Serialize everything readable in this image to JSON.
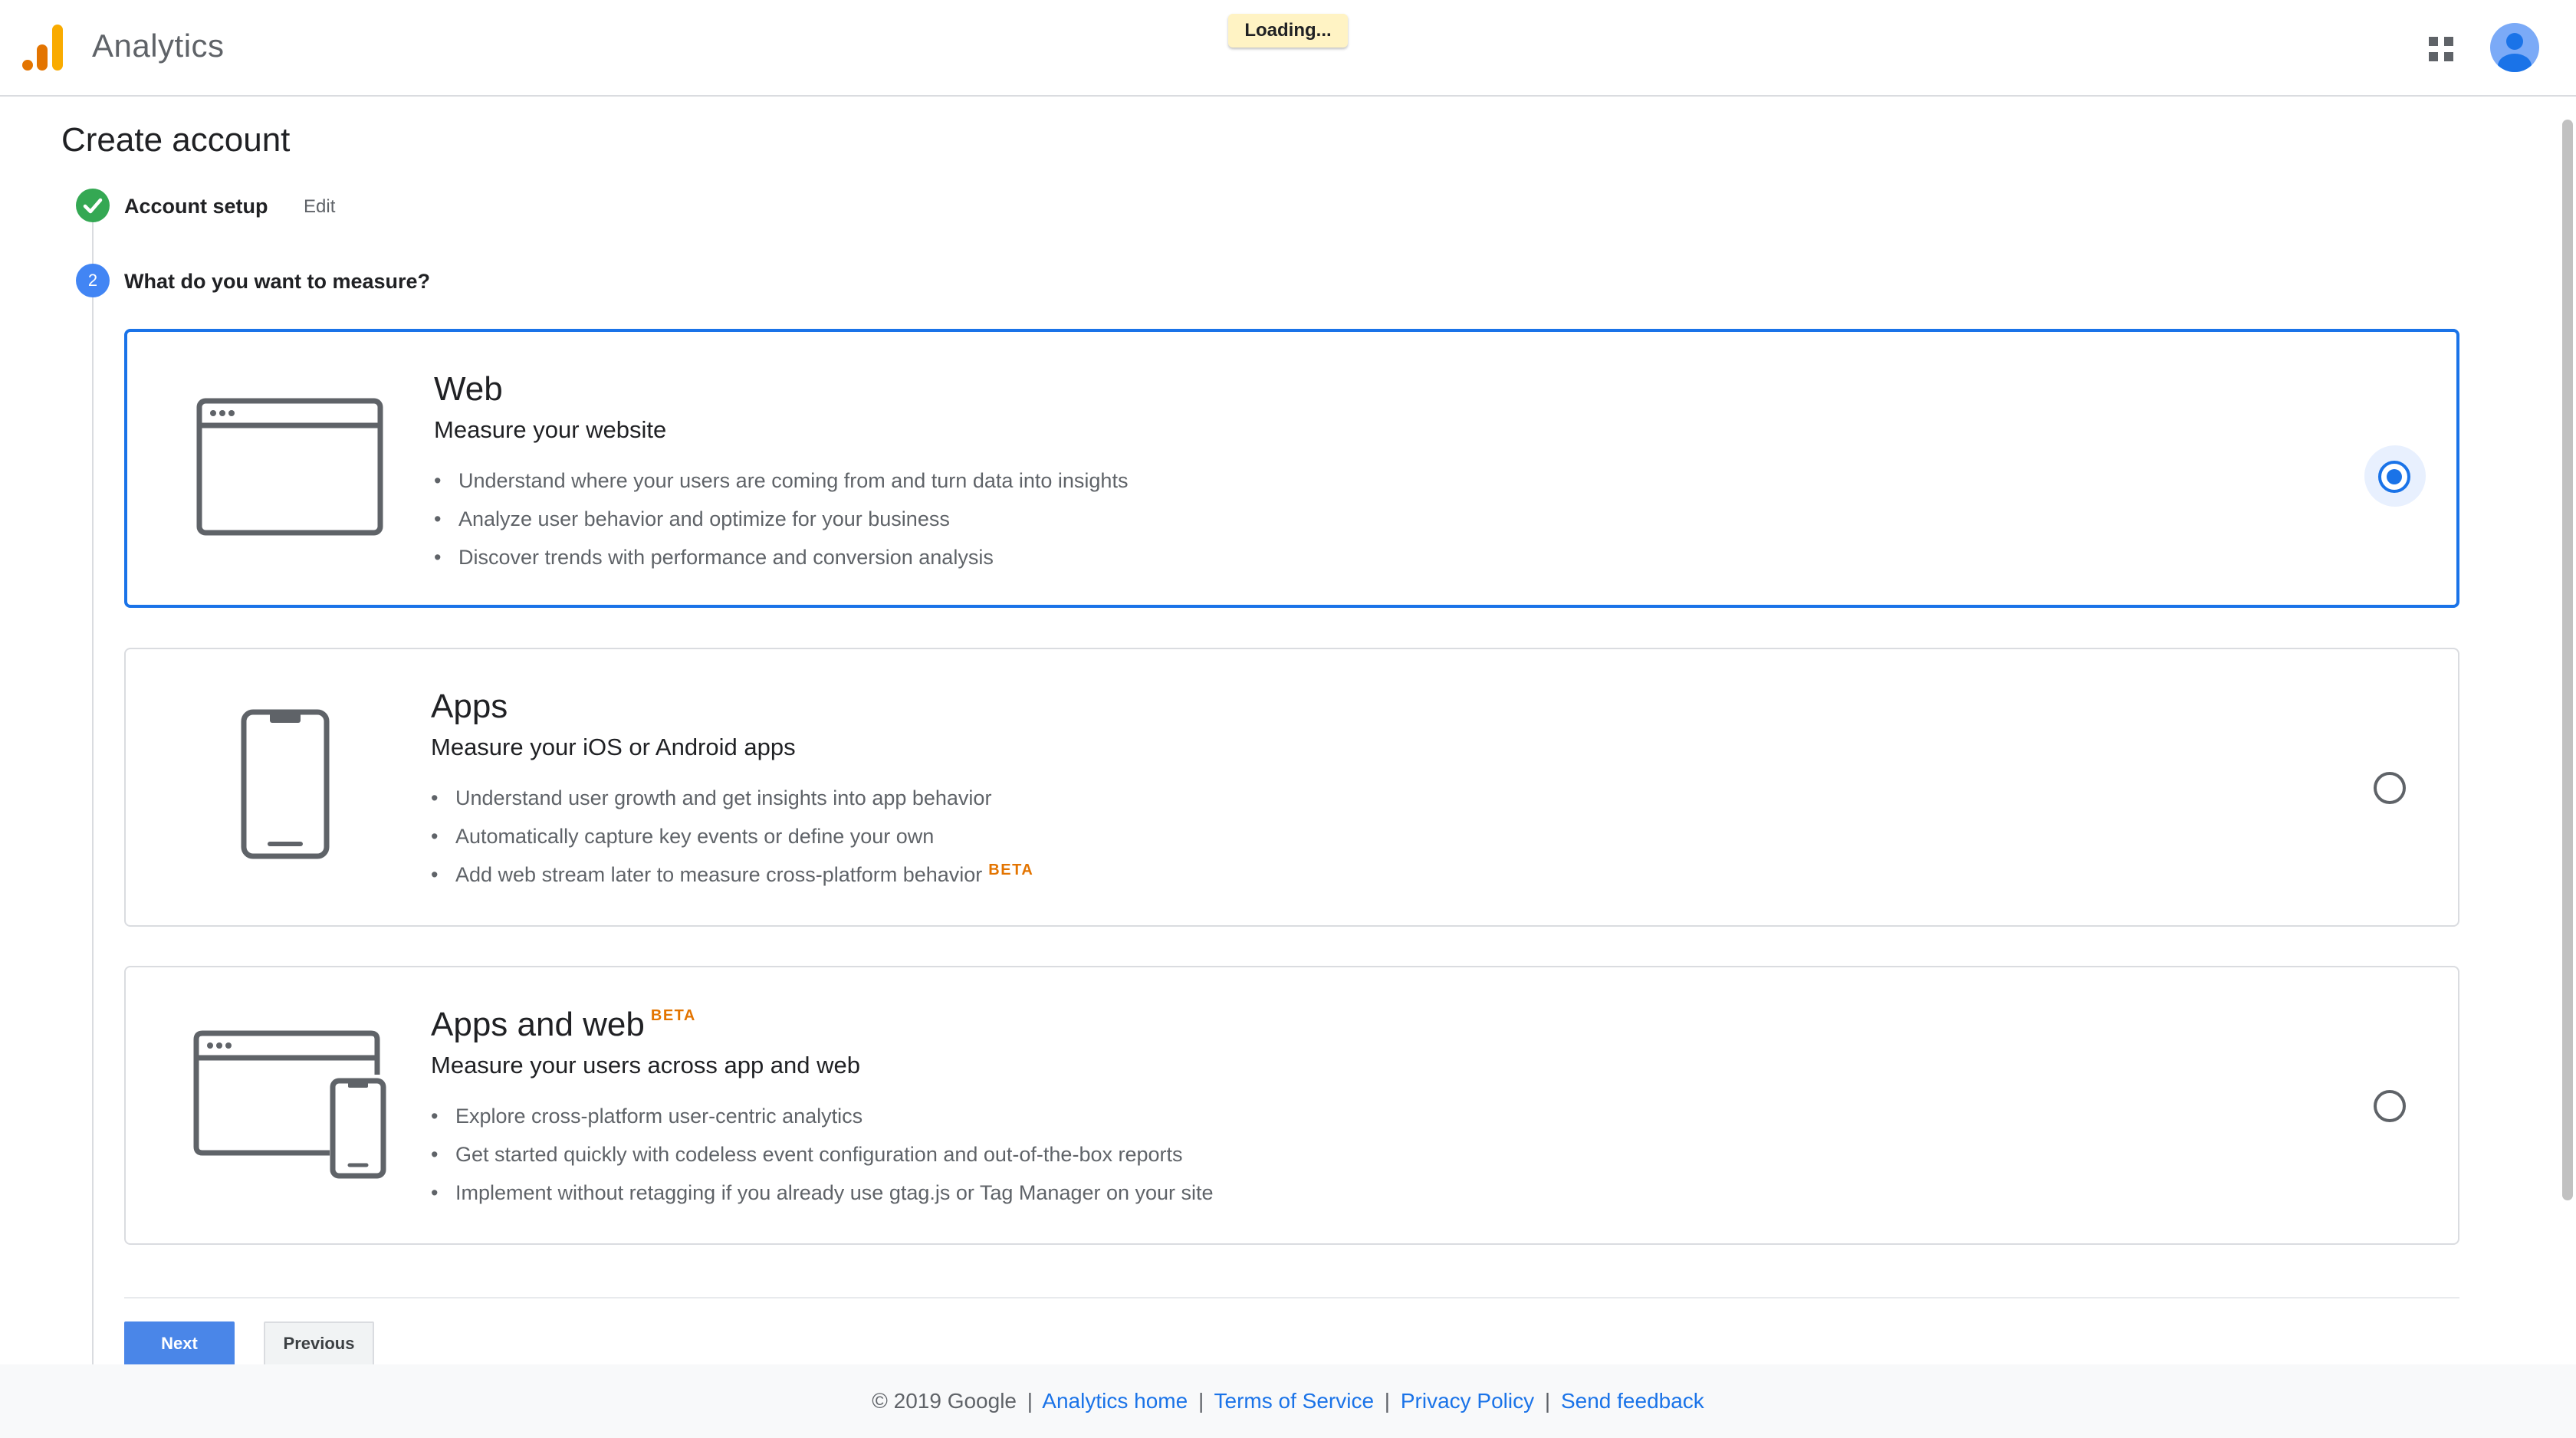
{
  "header": {
    "app_name": "Analytics",
    "loading": "Loading..."
  },
  "page": {
    "title": "Create account"
  },
  "steps": [
    {
      "number": "",
      "label": "Account setup",
      "status": "complete",
      "edit": "Edit"
    },
    {
      "number": "2",
      "label": "What do you want to measure?",
      "status": "active"
    }
  ],
  "cards": [
    {
      "title": "Web",
      "subtitle": "Measure your website",
      "bullets": [
        "Understand where your users are coming from and turn data into insights",
        "Analyze user behavior and optimize for your business",
        "Discover trends with performance and conversion analysis"
      ],
      "selected": true
    },
    {
      "title": "Apps",
      "subtitle": "Measure your iOS or Android apps",
      "bullets": [
        "Understand user growth and get insights into app behavior",
        "Automatically capture key events or define your own",
        "Add web stream later to measure cross-platform behavior"
      ],
      "bullet_badge": "BETA",
      "selected": false
    },
    {
      "title": "Apps and web",
      "title_badge": "BETA",
      "subtitle": "Measure your users across app and web",
      "bullets": [
        "Explore cross-platform user-centric analytics",
        "Get started quickly with codeless event configuration and out-of-the-box reports",
        "Implement without retagging if you already use gtag.js or Tag Manager on your site"
      ],
      "selected": false
    }
  ],
  "buttons": {
    "next": "Next",
    "previous": "Previous"
  },
  "footer": {
    "copyright": "© 2019 Google",
    "sep": "|",
    "links": [
      "Analytics home",
      "Terms of Service",
      "Privacy Policy",
      "Send feedback"
    ]
  },
  "colors": {
    "accent": "#1a73e8",
    "step_complete": "#34a853",
    "beta": "#e37400",
    "logo": [
      "#f9ab00",
      "#e37400",
      "#e37400"
    ]
  },
  "icons": [
    "analytics-logo-icon",
    "apps-grid-icon",
    "account-avatar-icon",
    "check-icon",
    "browser-window-icon",
    "phone-icon",
    "browser-and-phone-icon"
  ]
}
